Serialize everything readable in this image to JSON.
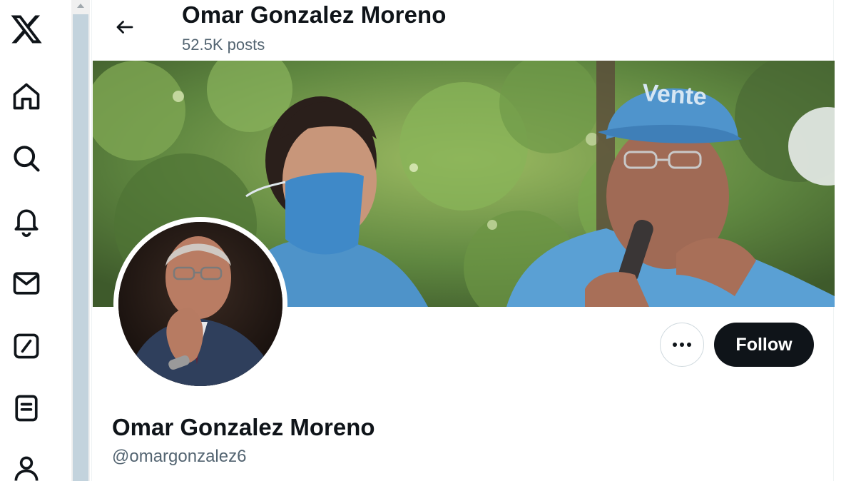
{
  "nav": {
    "items": [
      {
        "icon": "x-logo-icon"
      },
      {
        "icon": "home-icon"
      },
      {
        "icon": "search-icon"
      },
      {
        "icon": "bell-icon"
      },
      {
        "icon": "mail-icon"
      },
      {
        "icon": "grok-icon"
      },
      {
        "icon": "lists-icon"
      },
      {
        "icon": "profile-icon"
      }
    ]
  },
  "header": {
    "title": "Omar Gonzalez Moreno",
    "posts_count": "52.5K posts"
  },
  "banner": {
    "cap_text": "Vente"
  },
  "actions": {
    "follow_label": "Follow",
    "more_icon": "more-icon"
  },
  "profile": {
    "name": "Omar Gonzalez Moreno",
    "handle": "@omargonzalez6"
  },
  "colors": {
    "text": "#0f1419",
    "secondary": "#536471",
    "follow_bg": "#0f1419",
    "scroll_thumb": "#c3d3dd"
  }
}
